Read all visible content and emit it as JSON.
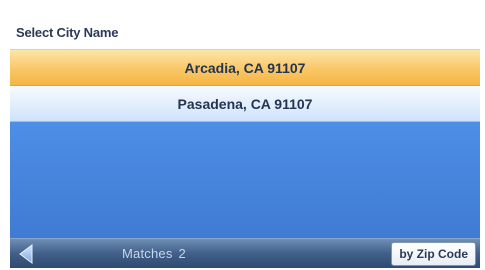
{
  "header": {
    "title": "Select City Name"
  },
  "results": [
    {
      "label": "Arcadia, CA 91107",
      "selected": true
    },
    {
      "label": "Pasadena, CA 91107",
      "selected": false
    }
  ],
  "footer": {
    "matches_label": "Matches",
    "matches_count": "2",
    "zip_button_label": "by Zip Code",
    "back_icon": "back-arrow-icon"
  },
  "colors": {
    "background_blue": "#4a84d8",
    "selected_row": "#f9c766",
    "footer_dark": "#415f88"
  }
}
